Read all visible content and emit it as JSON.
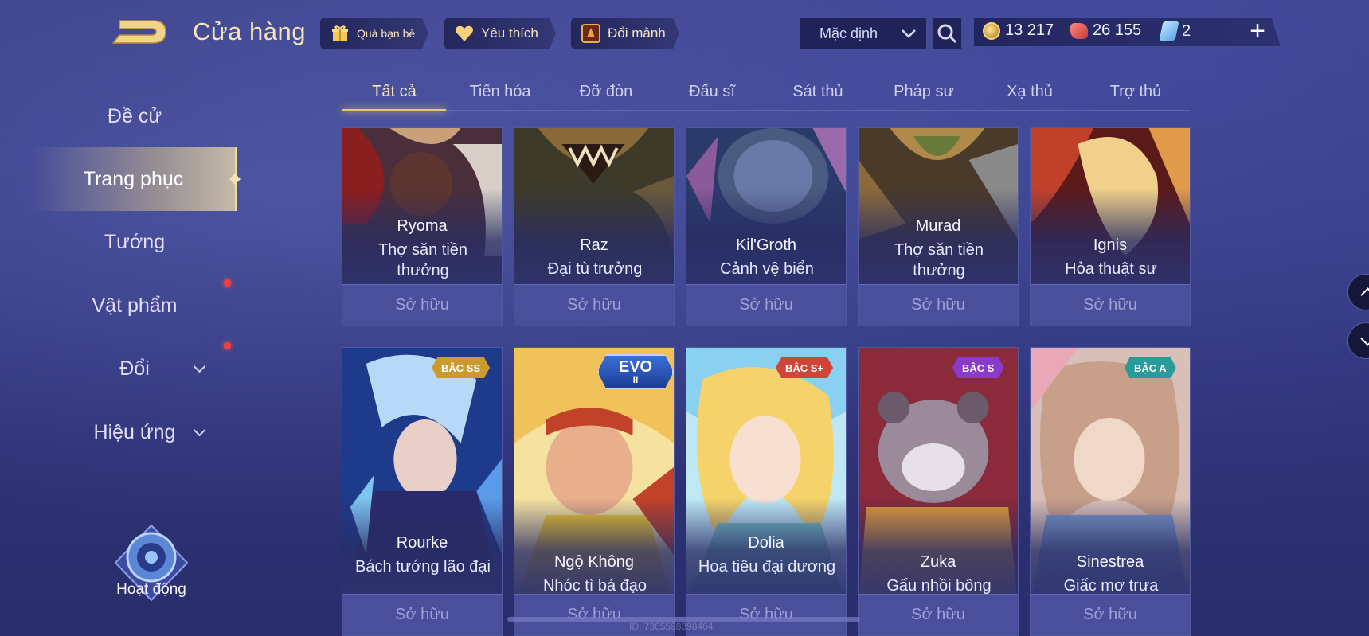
{
  "header": {
    "title": "Cửa hàng",
    "gift_label": "Quà bạn bè",
    "favorites_label": "Yêu thích",
    "exchange_label": "Đổi mảnh",
    "sort_value": "Mặc định"
  },
  "currency": {
    "gold": "13 217",
    "ruby": "26 155",
    "voucher": "2"
  },
  "sidebar": {
    "items": [
      {
        "label": "Đề cử"
      },
      {
        "label": "Trang phục"
      },
      {
        "label": "Tướng"
      },
      {
        "label": "Vật phẩm"
      },
      {
        "label": "Đổi"
      },
      {
        "label": "Hiệu ứng"
      }
    ],
    "event_label": "Hoạt động"
  },
  "tabs": [
    {
      "label": "Tất cả"
    },
    {
      "label": "Tiến hóa"
    },
    {
      "label": "Đỡ đòn"
    },
    {
      "label": "Đấu sĩ"
    },
    {
      "label": "Sát thủ"
    },
    {
      "label": "Pháp sư"
    },
    {
      "label": "Xạ thủ"
    },
    {
      "label": "Trợ thủ"
    }
  ],
  "cards_row1": [
    {
      "hero": "Ryoma",
      "skin": "Thợ săn tiền thưởng",
      "status": "Sở hữu",
      "colors": [
        "#5a2a2a",
        "#c8a07a",
        "#8b1e1e"
      ]
    },
    {
      "hero": "Raz",
      "skin": "Đại tù trưởng",
      "status": "Sở hữu",
      "colors": [
        "#3d3a2a",
        "#8a6a3a",
        "#5a4a2a"
      ]
    },
    {
      "hero": "Kil'Groth",
      "skin": "Cảnh vệ biển",
      "status": "Sở hữu",
      "colors": [
        "#2a3a6a",
        "#6a7aa8",
        "#8a5a9a"
      ]
    },
    {
      "hero": "Murad",
      "skin": "Thợ săn tiền thưởng",
      "status": "Sở hữu",
      "colors": [
        "#4a3a2a",
        "#b08a4a",
        "#6a6a6a"
      ]
    },
    {
      "hero": "Ignis",
      "skin": "Hỏa thuật sư",
      "status": "Sở hữu",
      "colors": [
        "#5a1a1a",
        "#e09a4a",
        "#f0d08a"
      ]
    }
  ],
  "cards_row2": [
    {
      "hero": "Rourke",
      "skin": "Bách tướng lão đại",
      "status": "Sở hữu",
      "badge": "BẬC SS",
      "badge_color": "#c99a2e",
      "colors": [
        "#1e3a8a",
        "#7fc4f0",
        "#2a2a6a"
      ]
    },
    {
      "hero": "Ngộ Không",
      "skin": "Nhóc tì bá đạo",
      "status": "Sở hữu",
      "badge": "EVO",
      "badge_sub": "II",
      "colors": [
        "#c2412a",
        "#f2c25a",
        "#f6e2a0"
      ]
    },
    {
      "hero": "Dolia",
      "skin": "Hoa tiêu đại dương",
      "status": "Sở hữu",
      "badge": "BẬC S+",
      "badge_color": "#d0443a",
      "colors": [
        "#2a9ad8",
        "#f5d36a",
        "#bfe8f5"
      ]
    },
    {
      "hero": "Zuka",
      "skin": "Gấu nhồi bông",
      "status": "Sở hữu",
      "badge": "BẬC S",
      "badge_color": "#8a3ac8",
      "colors": [
        "#8a2a3a",
        "#e09a3a",
        "#4a3a5a"
      ]
    },
    {
      "hero": "Sinestrea",
      "skin": "Giấc mơ trưa",
      "status": "Sở hữu",
      "badge": "BẬC A",
      "badge_color": "#2a9a9a",
      "colors": [
        "#c8a08a",
        "#f0d8c8",
        "#7a9ac8"
      ]
    }
  ],
  "footer": {
    "uid": "ID: 7365598398464"
  },
  "icons": [
    "back-icon",
    "gift-icon",
    "heart-icon",
    "shard-icon",
    "chevron-down-icon",
    "search-icon",
    "gold-coin-icon",
    "ruby-icon",
    "voucher-icon",
    "plus-icon",
    "event-icon",
    "scroll-up-icon",
    "scroll-down-icon"
  ]
}
